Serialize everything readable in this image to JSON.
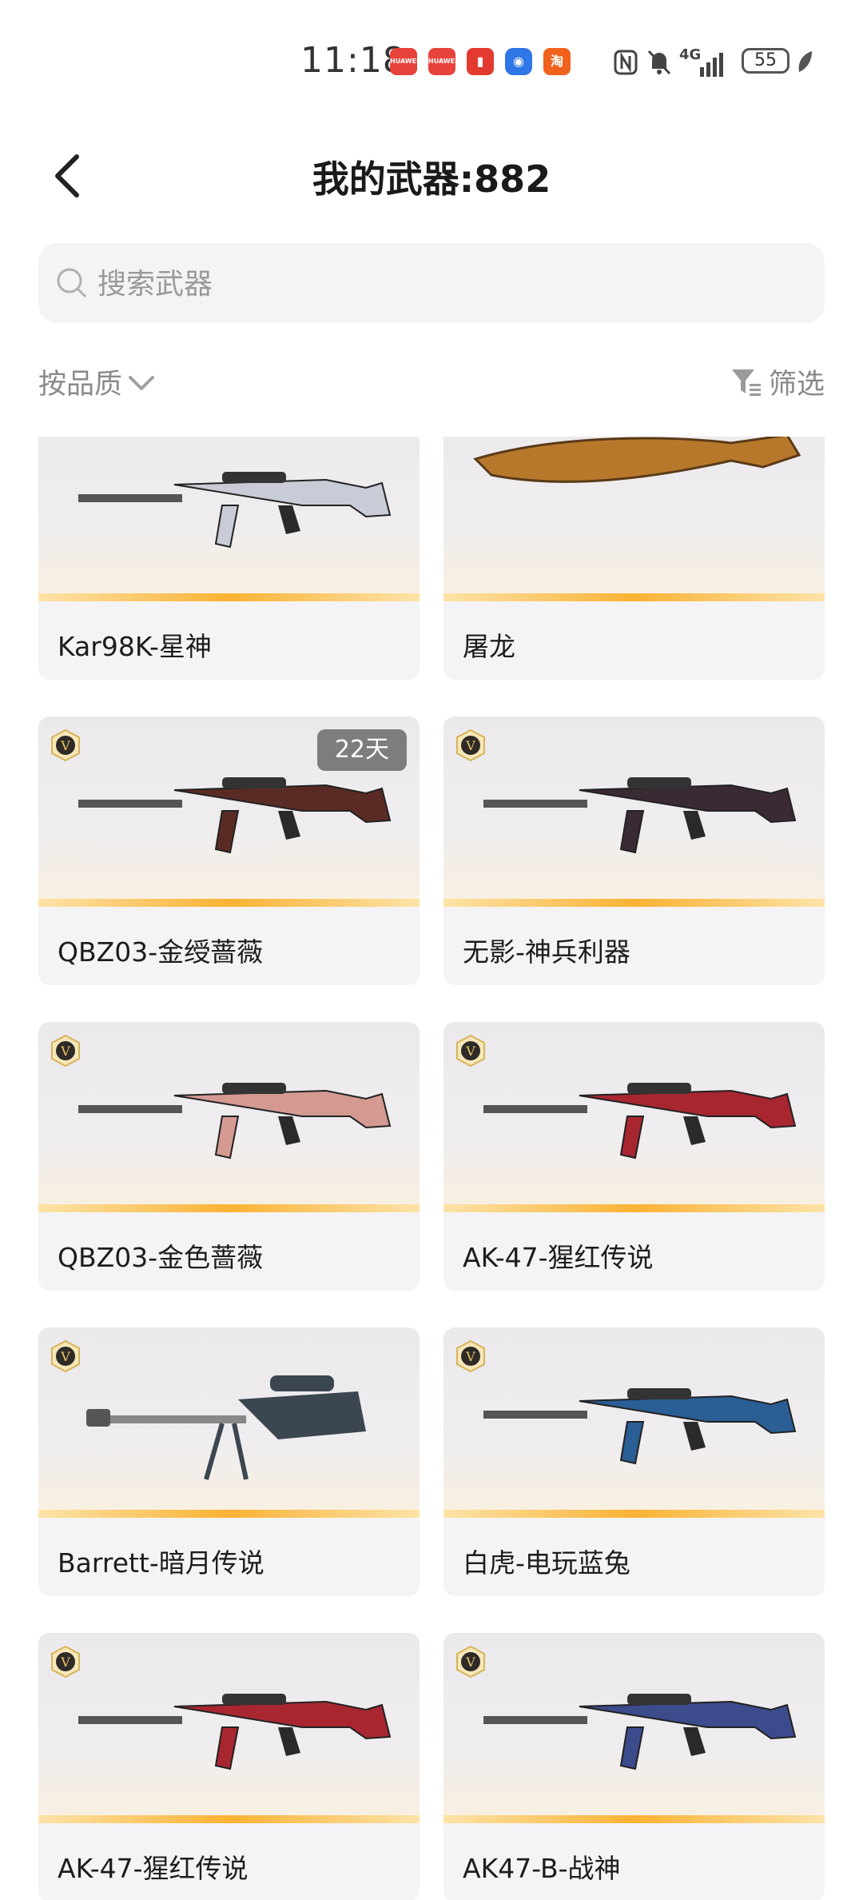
{
  "status_bar": {
    "time": "11:18",
    "notifications": [
      {
        "icon": "huawei-appgallery-icon",
        "color": "#e8423c",
        "label": "HUAWEI"
      },
      {
        "icon": "huawei-appgallery-icon",
        "color": "#e8423c",
        "label": "HUAWEI"
      },
      {
        "icon": "red-app-icon",
        "color": "#e23a2e",
        "label": ""
      },
      {
        "icon": "blue-app-icon",
        "color": "#2f76e6",
        "label": ""
      },
      {
        "icon": "taobao-icon",
        "color": "#f0621e",
        "label": "淘"
      }
    ],
    "network": "4G",
    "battery": "55"
  },
  "header": {
    "title": "我的武器:882"
  },
  "search": {
    "placeholder": "搜索武器",
    "value": ""
  },
  "toolbar": {
    "sort_label": "按品质",
    "filter_label": "筛选"
  },
  "weapons": [
    {
      "name": "Kar98K-星神",
      "badge": "",
      "days": "",
      "gun_color": "#c9ccd6"
    },
    {
      "name": "屠龙",
      "badge": "",
      "days": "",
      "gun_color": "#b8782c"
    },
    {
      "name": "QBZ03-金绶蔷薇",
      "badge": "V",
      "days": "22天",
      "gun_color": "#5a2b24"
    },
    {
      "name": "无影-神兵利器",
      "badge": "V",
      "days": "",
      "gun_color": "#3a2a34"
    },
    {
      "name": "QBZ03-金色蔷薇",
      "badge": "V",
      "days": "",
      "gun_color": "#d49a92"
    },
    {
      "name": "AK-47-猩红传说",
      "badge": "V",
      "days": "",
      "gun_color": "#a82630"
    },
    {
      "name": "Barrett-暗月传说",
      "badge": "V",
      "days": "",
      "gun_color": "#3b4650"
    },
    {
      "name": "白虎-电玩蓝兔",
      "badge": "V",
      "days": "",
      "gun_color": "#2a5e94"
    },
    {
      "name": "AK-47-猩红传说",
      "badge": "V",
      "days": "",
      "gun_color": "#a82630"
    },
    {
      "name": "AK47-B-战神",
      "badge": "V",
      "days": "",
      "gun_color": "#3b4b8c"
    }
  ]
}
